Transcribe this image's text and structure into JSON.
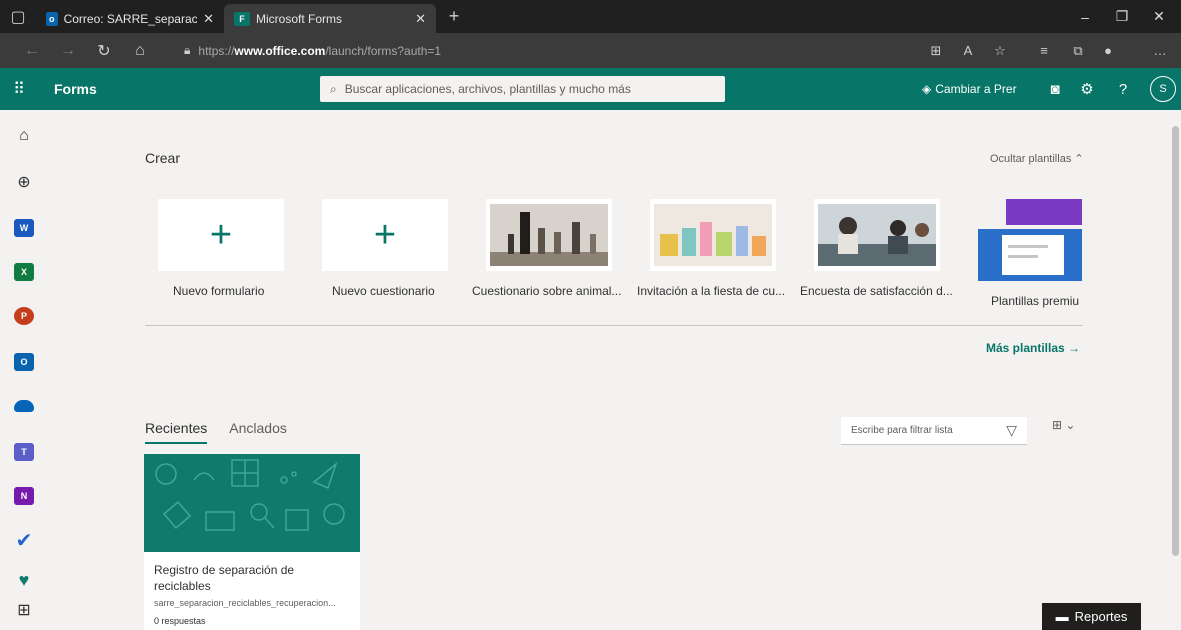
{
  "browser": {
    "tabs": [
      {
        "title": "Correo: SARRE_separacion_recicl",
        "favicon": "outlook-icon"
      },
      {
        "title": "Microsoft Forms",
        "favicon": "forms-icon"
      }
    ],
    "url_prefix": "https://",
    "url_domain": "www.office.com",
    "url_path": "/launch/forms?auth=1"
  },
  "header": {
    "app_name": "Forms",
    "search_placeholder": "Buscar aplicaciones, archivos, plantillas y mucho más",
    "premium_label": "Cambiar a Prer",
    "avatar_initial": "S"
  },
  "create": {
    "title": "Crear",
    "hide_templates": "Ocultar plantillas",
    "cards": [
      {
        "label": "Nuevo formulario"
      },
      {
        "label": "Nuevo cuestionario"
      },
      {
        "label": "Cuestionario sobre animal..."
      },
      {
        "label": "Invitación a la fiesta de cu..."
      },
      {
        "label": "Encuesta de satisfacción d..."
      },
      {
        "label": "Plantillas premiu"
      }
    ],
    "more_templates": "Más plantillas"
  },
  "recent": {
    "tabs": [
      "Recientes",
      "Anclados"
    ],
    "filter_placeholder": "Escribe para filtrar lista",
    "form": {
      "title": "Registro de separación de reciclables",
      "file": "sarre_separacion_reciclables_recuperacion...",
      "responses": "0 respuestas"
    }
  },
  "reportes_label": "Reportes",
  "colors": {
    "brand": "#077568",
    "chrome": "#202020"
  }
}
